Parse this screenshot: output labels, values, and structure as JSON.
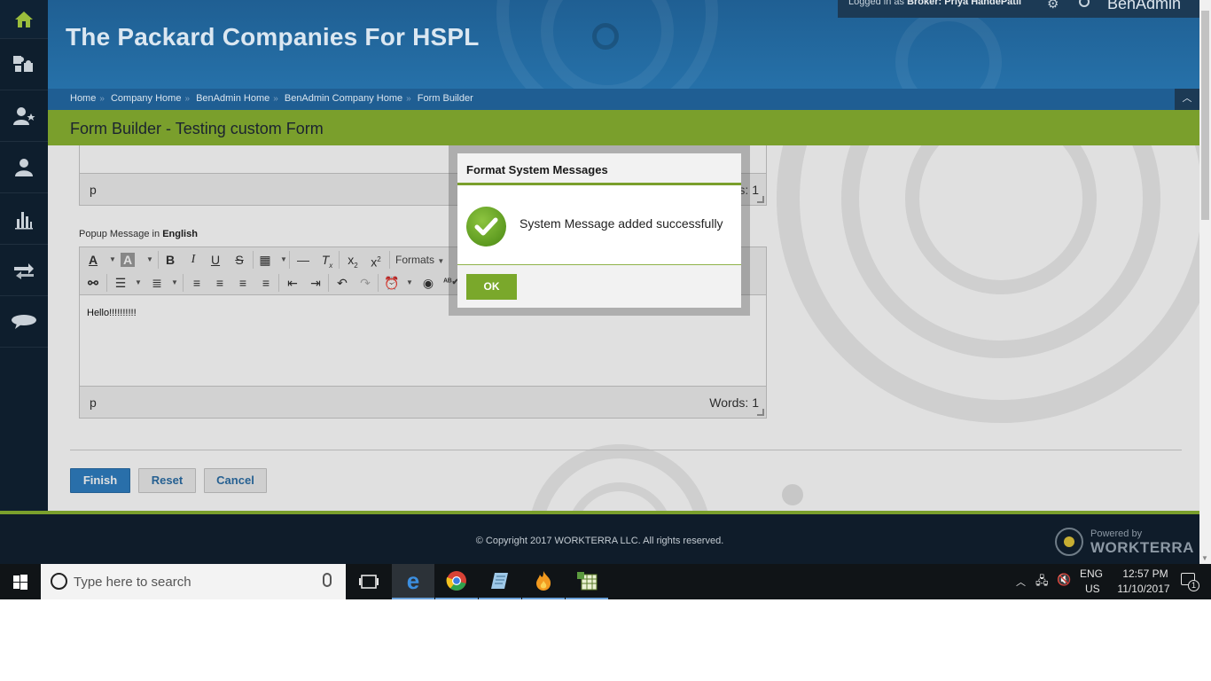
{
  "header": {
    "site_title": "The Packard Companies For HSPL",
    "logged_in_prefix": "Logged in as",
    "logged_in_role": "Broker:",
    "logged_in_user": "Priya HandePatil",
    "app_name": "BenAdmin"
  },
  "breadcrumb": [
    "Home",
    "Company Home",
    "BenAdmin Home",
    "BenAdmin Company Home",
    "Form Builder"
  ],
  "page_title": "Form Builder - Testing custom Form",
  "sidebar": {
    "items": [
      {
        "icon": "home-icon"
      },
      {
        "icon": "puzzle-icon"
      },
      {
        "icon": "user-star-icon"
      },
      {
        "icon": "user-icon"
      },
      {
        "icon": "bar-chart-icon"
      },
      {
        "icon": "swap-arrows-icon"
      },
      {
        "icon": "chat-bubble-icon"
      }
    ]
  },
  "editor_top": {
    "path": "p",
    "words": "Words: 1"
  },
  "popup_message": {
    "label": "Popup Message in",
    "language": "English",
    "formats_label": "Formats",
    "content": "Hello!!!!!!!!!!",
    "path": "p",
    "words": "Words: 1"
  },
  "actions": {
    "finish": "Finish",
    "reset": "Reset",
    "cancel": "Cancel"
  },
  "modal": {
    "title": "Format System Messages",
    "message": "System Message added successfully",
    "ok": "OK"
  },
  "footer": {
    "copyright": "© Copyright 2017 WORKTERRA LLC. All rights reserved.",
    "powered_by": "Powered by",
    "brand": "WORKTERRA"
  },
  "taskbar": {
    "search_placeholder": "Type here to search",
    "lang_line1": "ENG",
    "lang_line2": "US",
    "time": "12:57 PM",
    "date": "11/10/2017",
    "notification_count": "1"
  },
  "colors": {
    "header_blue": "#2671a9",
    "accent_green": "#7a9f2c",
    "sidebar_dark": "#0e1e2d",
    "finish_blue": "#2f7fc2"
  }
}
